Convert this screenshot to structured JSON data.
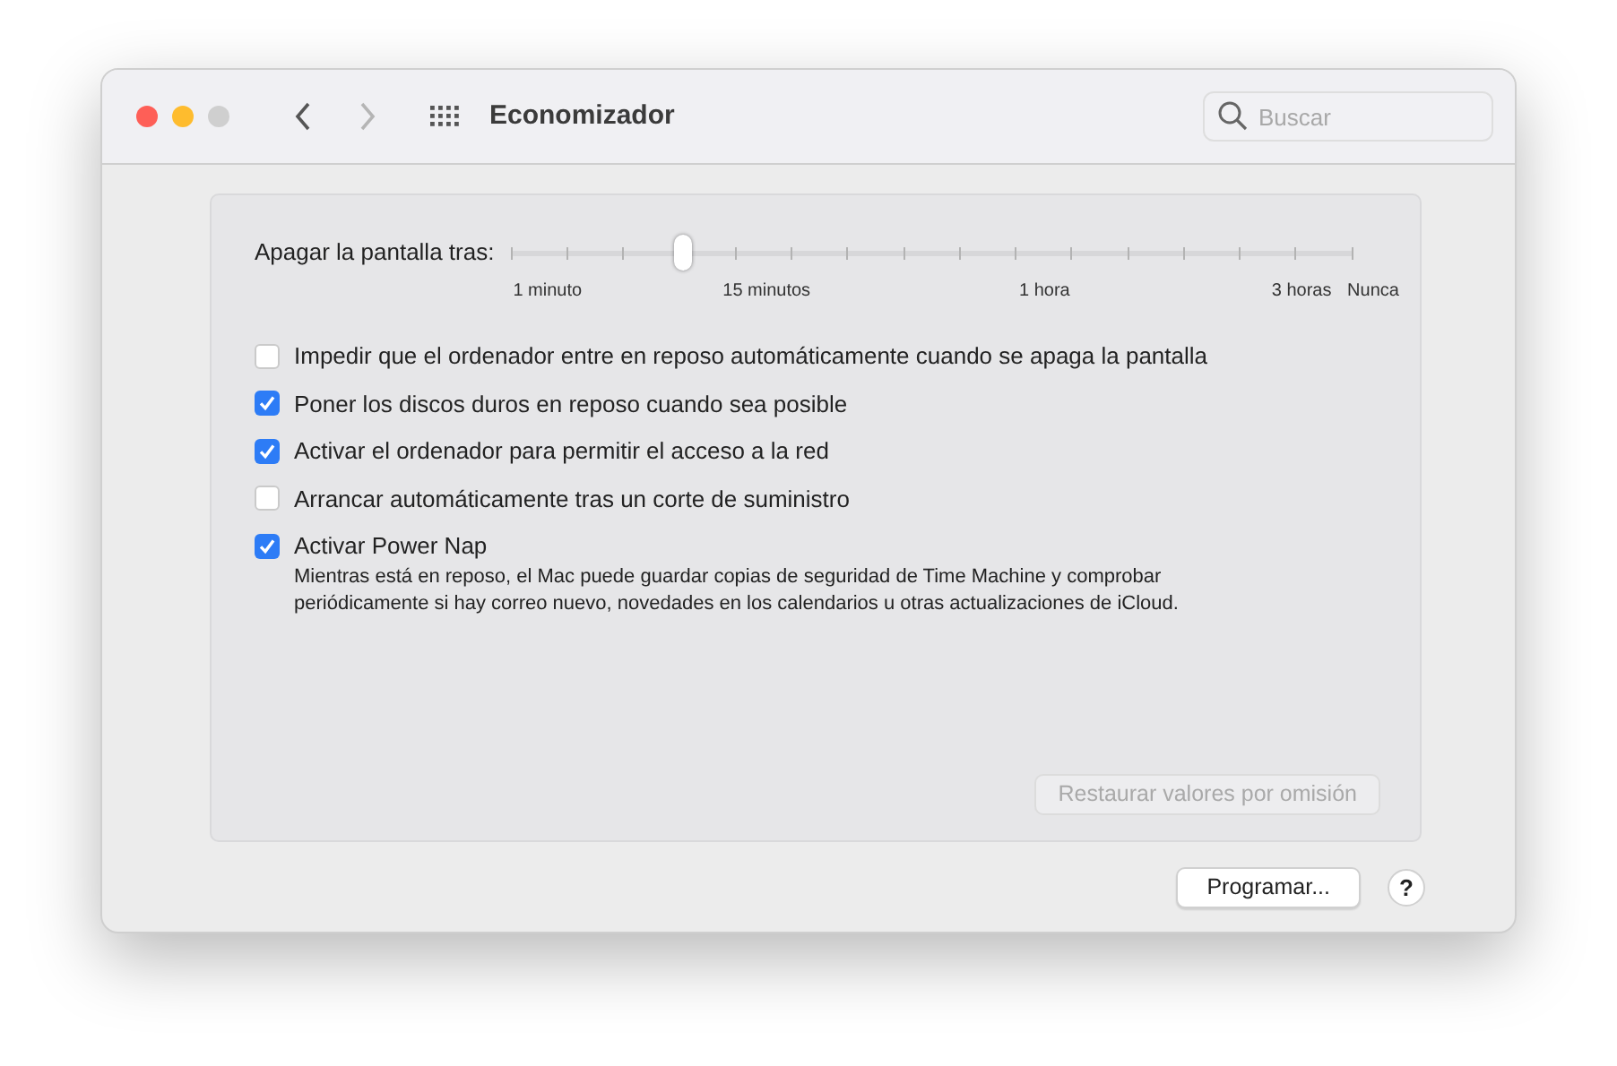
{
  "window": {
    "title": "Economizador",
    "search": {
      "placeholder": "Buscar"
    }
  },
  "slider": {
    "label": "Apagar la pantalla tras:",
    "level": 0.205,
    "ticks": [
      "1 minuto",
      "15 minutos",
      "1 hora",
      "3 horas",
      "Nunca"
    ]
  },
  "options": [
    {
      "label": "Impedir que el ordenador entre en reposo automáticamente cuando se apaga la pantalla",
      "checked": false
    },
    {
      "label": "Poner los discos duros en reposo cuando sea posible",
      "checked": true
    },
    {
      "label": "Activar el ordenador para permitir el acceso a la red",
      "checked": true
    },
    {
      "label": "Arrancar automáticamente tras un corte de suministro",
      "checked": false
    },
    {
      "label": "Activar Power Nap",
      "checked": true,
      "description": "Mientras está en reposo, el Mac puede guardar copias de seguridad de Time Machine y comprobar periódicamente si hay correo nuevo, novedades en los calendarios u otras actualizaciones de iCloud."
    }
  ],
  "restore_button": {
    "label": "Restaurar valores por omisión",
    "disabled": true
  },
  "schedule_button": {
    "label": "Programar..."
  },
  "help_button": {
    "label": "?"
  }
}
